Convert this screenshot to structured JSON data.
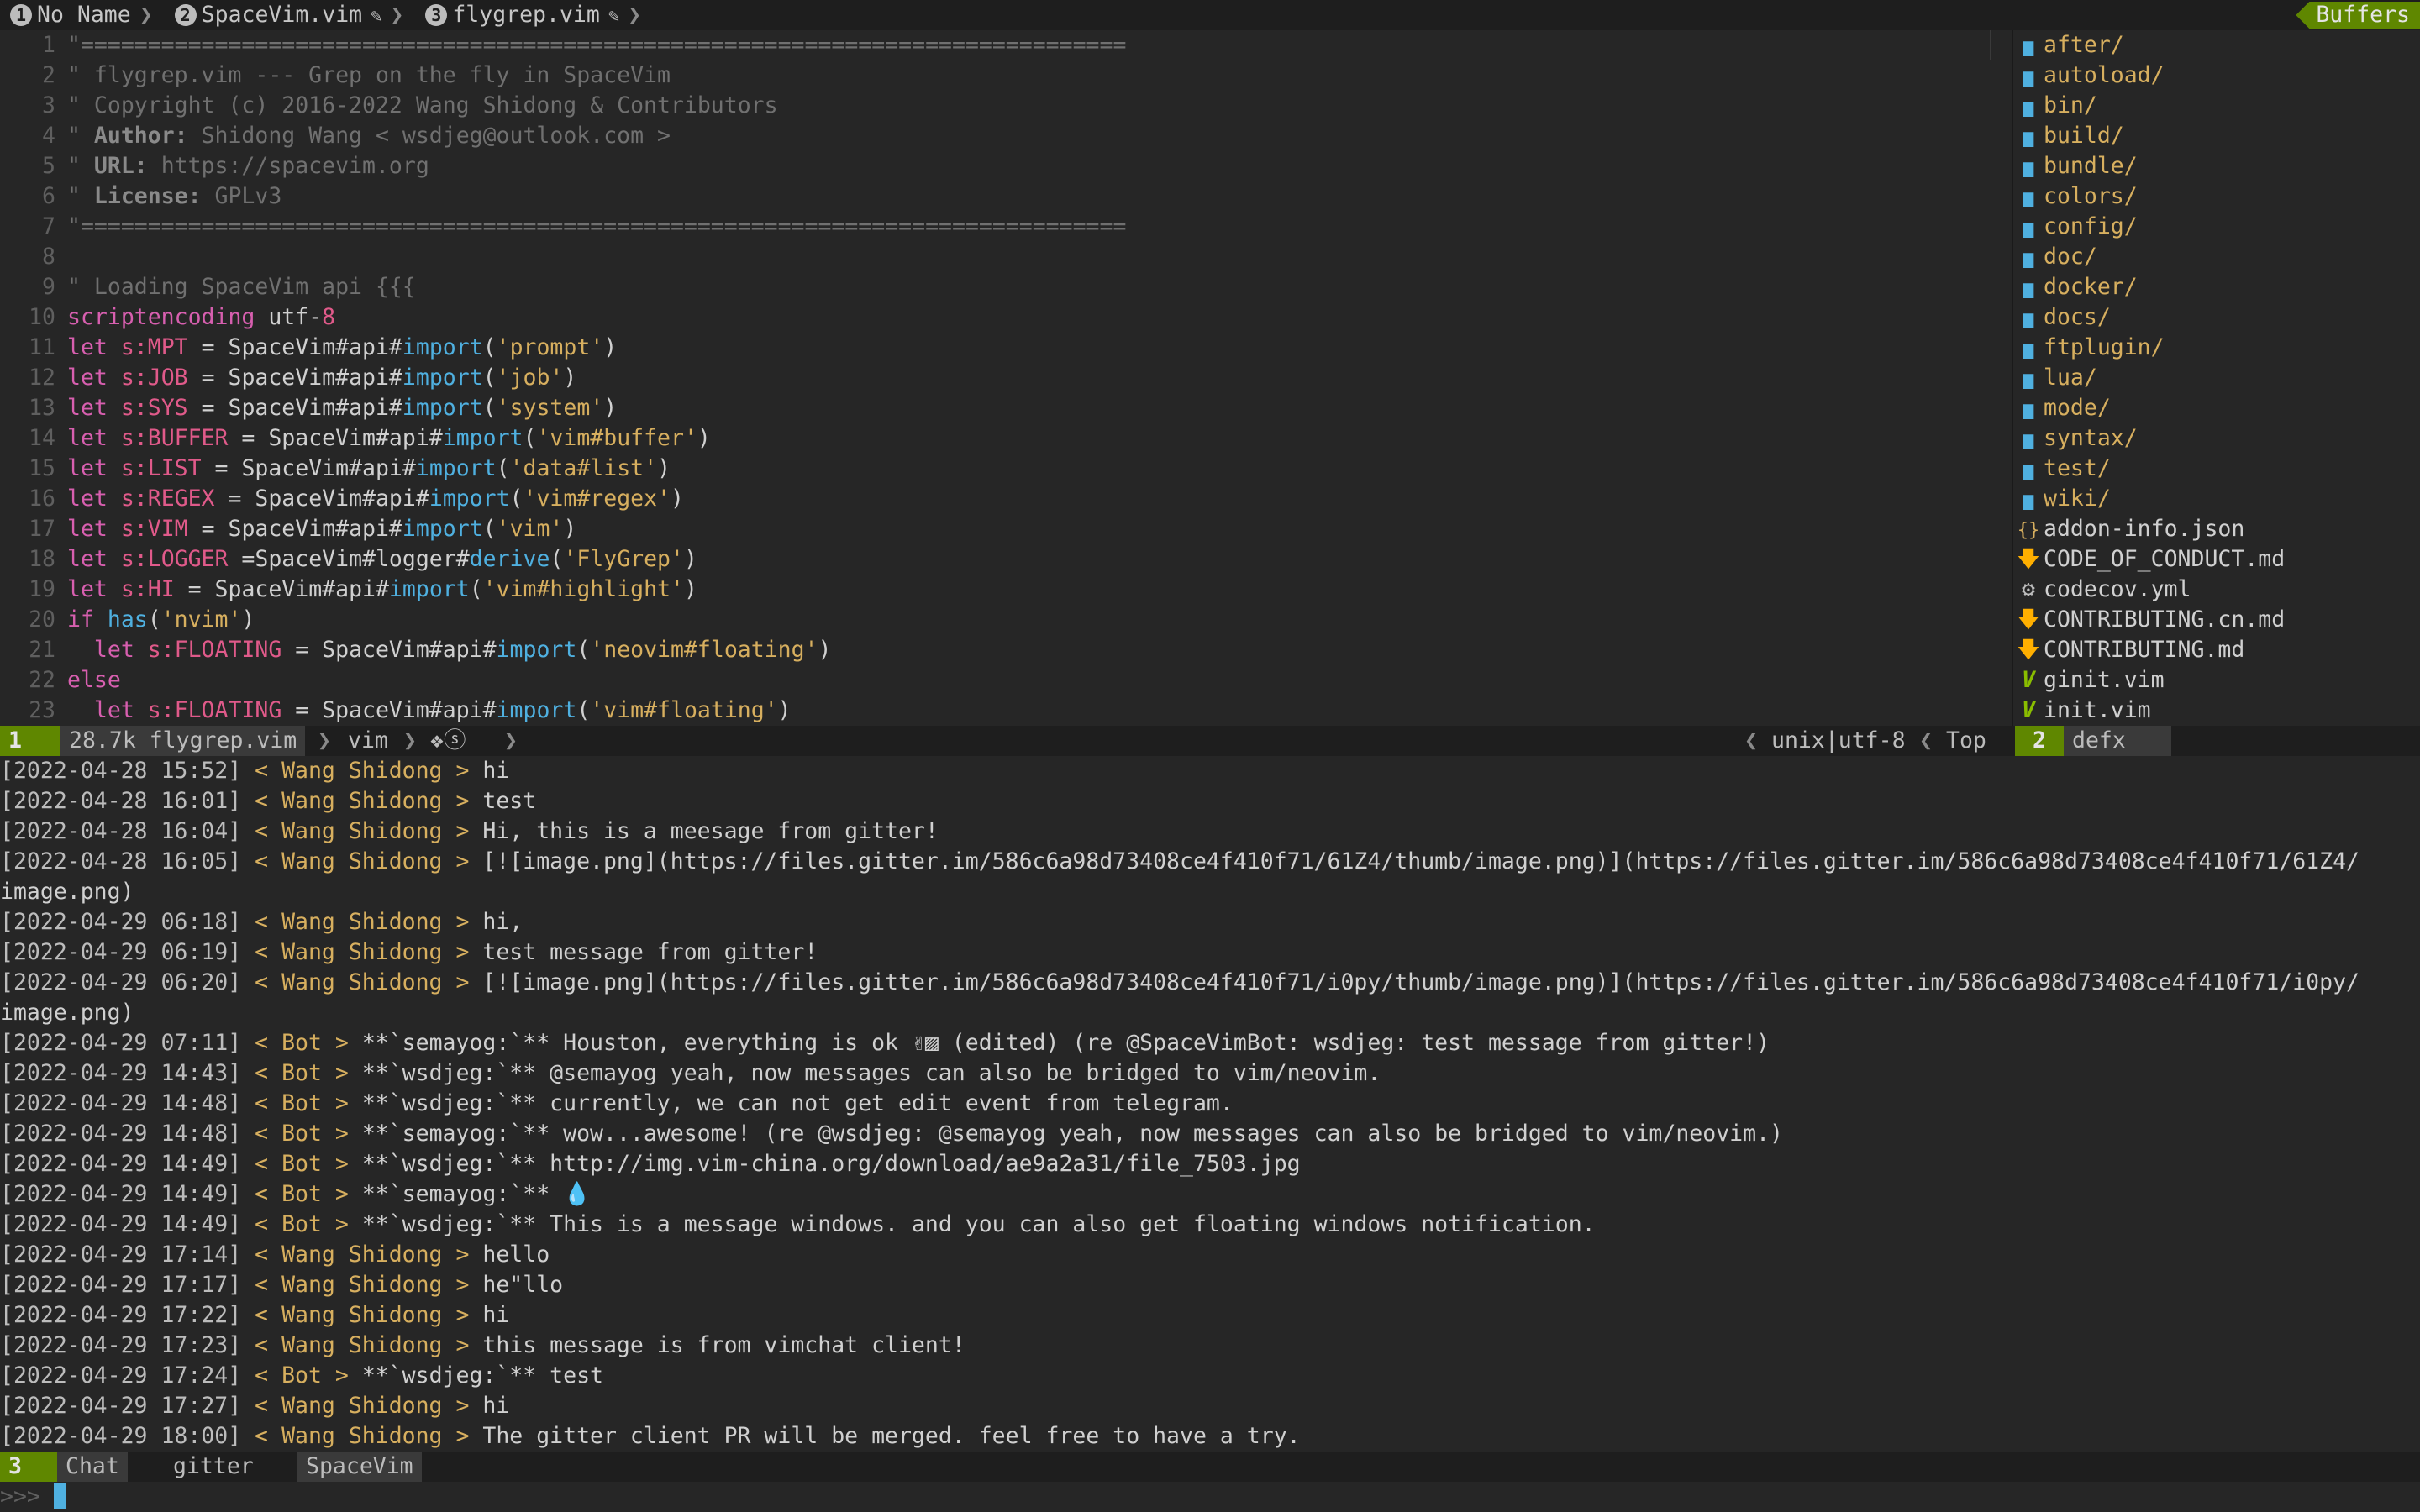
{
  "tabs": [
    {
      "num": "1",
      "label": "No Name",
      "modified": false
    },
    {
      "num": "2",
      "label": "SpaceVim.vim",
      "modified": true
    },
    {
      "num": "3",
      "label": "flygrep.vim",
      "modified": true
    }
  ],
  "buffers_label": "Buffers",
  "editor_lines": [
    {
      "n": "1",
      "tokens": [
        {
          "t": "\"==============================================================================",
          "c": "cmt"
        }
      ]
    },
    {
      "n": "2",
      "tokens": [
        {
          "t": "\" flygrep.vim --- Grep on the fly in SpaceVim",
          "c": "cmt"
        }
      ]
    },
    {
      "n": "3",
      "tokens": [
        {
          "t": "\" Copyright (c) 2016-2022 Wang Shidong & Contributors",
          "c": "cmt"
        }
      ]
    },
    {
      "n": "4",
      "tokens": [
        {
          "t": "\" ",
          "c": "cmt"
        },
        {
          "t": "Author:",
          "c": "bold"
        },
        {
          "t": " Shidong Wang < wsdjeg@outlook.com >",
          "c": "cmt"
        }
      ]
    },
    {
      "n": "5",
      "tokens": [
        {
          "t": "\" ",
          "c": "cmt"
        },
        {
          "t": "URL:",
          "c": "bold"
        },
        {
          "t": " https://spacevim.org",
          "c": "cmt"
        }
      ]
    },
    {
      "n": "6",
      "tokens": [
        {
          "t": "\" ",
          "c": "cmt"
        },
        {
          "t": "License:",
          "c": "bold"
        },
        {
          "t": " GPLv3",
          "c": "cmt"
        }
      ]
    },
    {
      "n": "7",
      "tokens": [
        {
          "t": "\"==============================================================================",
          "c": "cmt"
        }
      ]
    },
    {
      "n": "8",
      "tokens": []
    },
    {
      "n": "9",
      "tokens": [
        {
          "t": "\" Loading SpaceVim api {{{",
          "c": "cmt"
        }
      ]
    },
    {
      "n": "10",
      "tokens": [
        {
          "t": "scriptencoding",
          "c": "kw"
        },
        {
          "t": " utf-",
          "c": ""
        },
        {
          "t": "8",
          "c": "var"
        }
      ]
    },
    {
      "n": "11",
      "tokens": [
        {
          "t": "let ",
          "c": "kw"
        },
        {
          "t": "s:MPT",
          "c": "var"
        },
        {
          "t": " = ",
          "c": ""
        },
        {
          "t": "SpaceVim#api#",
          "c": ""
        },
        {
          "t": "import",
          "c": "fn"
        },
        {
          "t": "(",
          "c": ""
        },
        {
          "t": "'prompt'",
          "c": "str"
        },
        {
          "t": ")",
          "c": ""
        }
      ]
    },
    {
      "n": "12",
      "tokens": [
        {
          "t": "let ",
          "c": "kw"
        },
        {
          "t": "s:JOB",
          "c": "var"
        },
        {
          "t": " = ",
          "c": ""
        },
        {
          "t": "SpaceVim#api#",
          "c": ""
        },
        {
          "t": "import",
          "c": "fn"
        },
        {
          "t": "(",
          "c": ""
        },
        {
          "t": "'job'",
          "c": "str"
        },
        {
          "t": ")",
          "c": ""
        }
      ]
    },
    {
      "n": "13",
      "tokens": [
        {
          "t": "let ",
          "c": "kw"
        },
        {
          "t": "s:SYS",
          "c": "var"
        },
        {
          "t": " = ",
          "c": ""
        },
        {
          "t": "SpaceVim#api#",
          "c": ""
        },
        {
          "t": "import",
          "c": "fn"
        },
        {
          "t": "(",
          "c": ""
        },
        {
          "t": "'system'",
          "c": "str"
        },
        {
          "t": ")",
          "c": ""
        }
      ]
    },
    {
      "n": "14",
      "tokens": [
        {
          "t": "let ",
          "c": "kw"
        },
        {
          "t": "s:BUFFER",
          "c": "var"
        },
        {
          "t": " = ",
          "c": ""
        },
        {
          "t": "SpaceVim#api#",
          "c": ""
        },
        {
          "t": "import",
          "c": "fn"
        },
        {
          "t": "(",
          "c": ""
        },
        {
          "t": "'vim#buffer'",
          "c": "str"
        },
        {
          "t": ")",
          "c": ""
        }
      ]
    },
    {
      "n": "15",
      "tokens": [
        {
          "t": "let ",
          "c": "kw"
        },
        {
          "t": "s:LIST",
          "c": "var"
        },
        {
          "t": " = ",
          "c": ""
        },
        {
          "t": "SpaceVim#api#",
          "c": ""
        },
        {
          "t": "import",
          "c": "fn"
        },
        {
          "t": "(",
          "c": ""
        },
        {
          "t": "'data#list'",
          "c": "str"
        },
        {
          "t": ")",
          "c": ""
        }
      ]
    },
    {
      "n": "16",
      "tokens": [
        {
          "t": "let ",
          "c": "kw"
        },
        {
          "t": "s:REGEX",
          "c": "var"
        },
        {
          "t": " = ",
          "c": ""
        },
        {
          "t": "SpaceVim#api#",
          "c": ""
        },
        {
          "t": "import",
          "c": "fn"
        },
        {
          "t": "(",
          "c": ""
        },
        {
          "t": "'vim#regex'",
          "c": "str"
        },
        {
          "t": ")",
          "c": ""
        }
      ]
    },
    {
      "n": "17",
      "tokens": [
        {
          "t": "let ",
          "c": "kw"
        },
        {
          "t": "s:VIM",
          "c": "var"
        },
        {
          "t": " = ",
          "c": ""
        },
        {
          "t": "SpaceVim#api#",
          "c": ""
        },
        {
          "t": "import",
          "c": "fn"
        },
        {
          "t": "(",
          "c": ""
        },
        {
          "t": "'vim'",
          "c": "str"
        },
        {
          "t": ")",
          "c": ""
        }
      ]
    },
    {
      "n": "18",
      "tokens": [
        {
          "t": "let ",
          "c": "kw"
        },
        {
          "t": "s:LOGGER",
          "c": "var"
        },
        {
          "t": " =",
          "c": ""
        },
        {
          "t": "SpaceVim#logger#",
          "c": ""
        },
        {
          "t": "derive",
          "c": "fn"
        },
        {
          "t": "(",
          "c": ""
        },
        {
          "t": "'FlyGrep'",
          "c": "str"
        },
        {
          "t": ")",
          "c": ""
        }
      ]
    },
    {
      "n": "19",
      "tokens": [
        {
          "t": "let ",
          "c": "kw"
        },
        {
          "t": "s:HI",
          "c": "var"
        },
        {
          "t": " = ",
          "c": ""
        },
        {
          "t": "SpaceVim#api#",
          "c": ""
        },
        {
          "t": "import",
          "c": "fn"
        },
        {
          "t": "(",
          "c": ""
        },
        {
          "t": "'vim#highlight'",
          "c": "str"
        },
        {
          "t": ")",
          "c": ""
        }
      ]
    },
    {
      "n": "20",
      "tokens": [
        {
          "t": "if ",
          "c": "kw"
        },
        {
          "t": "has",
          "c": "fn"
        },
        {
          "t": "(",
          "c": ""
        },
        {
          "t": "'nvim'",
          "c": "str"
        },
        {
          "t": ")",
          "c": ""
        }
      ]
    },
    {
      "n": "21",
      "tokens": [
        {
          "t": "  let ",
          "c": "kw"
        },
        {
          "t": "s:FLOATING",
          "c": "var"
        },
        {
          "t": " = ",
          "c": ""
        },
        {
          "t": "SpaceVim#api#",
          "c": ""
        },
        {
          "t": "import",
          "c": "fn"
        },
        {
          "t": "(",
          "c": ""
        },
        {
          "t": "'neovim#floating'",
          "c": "str"
        },
        {
          "t": ")",
          "c": ""
        }
      ]
    },
    {
      "n": "22",
      "tokens": [
        {
          "t": "else",
          "c": "kw"
        }
      ]
    },
    {
      "n": "23",
      "tokens": [
        {
          "t": "  let ",
          "c": "kw"
        },
        {
          "t": "s:FLOATING",
          "c": "var"
        },
        {
          "t": " = ",
          "c": ""
        },
        {
          "t": "SpaceVim#api#",
          "c": ""
        },
        {
          "t": "import",
          "c": "fn"
        },
        {
          "t": "(",
          "c": ""
        },
        {
          "t": "'vim#floating'",
          "c": "str"
        },
        {
          "t": ")",
          "c": ""
        }
      ]
    }
  ],
  "defx": [
    {
      "name": "after/",
      "kind": "dir",
      "icon": "folder-icon"
    },
    {
      "name": "autoload/",
      "kind": "dir",
      "icon": "folder-icon"
    },
    {
      "name": "bin/",
      "kind": "dir",
      "icon": "folder-icon"
    },
    {
      "name": "build/",
      "kind": "dir",
      "icon": "folder-icon"
    },
    {
      "name": "bundle/",
      "kind": "dir",
      "icon": "folder-icon"
    },
    {
      "name": "colors/",
      "kind": "dir",
      "icon": "folder-icon"
    },
    {
      "name": "config/",
      "kind": "dir",
      "icon": "folder-icon"
    },
    {
      "name": "doc/",
      "kind": "dir",
      "icon": "folder-icon"
    },
    {
      "name": "docker/",
      "kind": "dir",
      "icon": "folder-icon"
    },
    {
      "name": "docs/",
      "kind": "dir",
      "icon": "folder-icon"
    },
    {
      "name": "ftplugin/",
      "kind": "dir",
      "icon": "folder-icon"
    },
    {
      "name": "lua/",
      "kind": "dir",
      "icon": "folder-icon"
    },
    {
      "name": "mode/",
      "kind": "dir",
      "icon": "folder-icon"
    },
    {
      "name": "syntax/",
      "kind": "dir",
      "icon": "folder-icon"
    },
    {
      "name": "test/",
      "kind": "dir",
      "icon": "folder-icon"
    },
    {
      "name": "wiki/",
      "kind": "dir",
      "icon": "folder-icon"
    },
    {
      "name": "addon-info.json",
      "kind": "file",
      "icon": "json-icon"
    },
    {
      "name": "CODE_OF_CONDUCT.md",
      "kind": "file",
      "icon": "markdown-icon"
    },
    {
      "name": "codecov.yml",
      "kind": "file",
      "icon": "gear-icon"
    },
    {
      "name": "CONTRIBUTING.cn.md",
      "kind": "file",
      "icon": "markdown-icon"
    },
    {
      "name": "CONTRIBUTING.md",
      "kind": "file",
      "icon": "markdown-icon"
    },
    {
      "name": "ginit.vim",
      "kind": "file",
      "icon": "vim-icon"
    },
    {
      "name": "init.vim",
      "kind": "file",
      "icon": "vim-icon"
    }
  ],
  "status1": {
    "win": "1",
    "size_file": "28.7k flygrep.vim",
    "filetype": "vim",
    "indicators": "❖ⓢ",
    "format": "unix|utf-8",
    "position": "Top",
    "win2": "2",
    "win2_name": "defx"
  },
  "chat": [
    {
      "ts": "[2022-04-28 15:52]",
      "nick": "Wang Shidong",
      "msg": "hi"
    },
    {
      "ts": "[2022-04-28 16:01]",
      "nick": "Wang Shidong",
      "msg": "test"
    },
    {
      "ts": "[2022-04-28 16:04]",
      "nick": "Wang Shidong",
      "msg": "Hi, this is a meesage from gitter!"
    },
    {
      "ts": "[2022-04-28 16:05]",
      "nick": "Wang Shidong",
      "msg": "[![image.png](https://files.gitter.im/586c6a98d73408ce4f410f71/61Z4/thumb/image.png)](https://files.gitter.im/586c6a98d73408ce4f410f71/61Z4/",
      "cont": "image.png)"
    },
    {
      "ts": "[2022-04-29 06:18]",
      "nick": "Wang Shidong",
      "msg": "hi,"
    },
    {
      "ts": "[2022-04-29 06:19]",
      "nick": "Wang Shidong",
      "msg": "test message from gitter!"
    },
    {
      "ts": "[2022-04-29 06:20]",
      "nick": "Wang Shidong",
      "msg": "[![image.png](https://files.gitter.im/586c6a98d73408ce4f410f71/i0py/thumb/image.png)](https://files.gitter.im/586c6a98d73408ce4f410f71/i0py/",
      "cont": "image.png)"
    },
    {
      "ts": "[2022-04-29 07:11]",
      "nick": "Bot",
      "msg": "**`semayog:`** Houston, everything is ok ✌▨ (edited) (re @SpaceVimBot: wsdjeg: test message from gitter!)"
    },
    {
      "ts": "[2022-04-29 14:43]",
      "nick": "Bot",
      "msg": "**`wsdjeg:`** @semayog yeah, now messages can also be bridged to vim/neovim."
    },
    {
      "ts": "[2022-04-29 14:48]",
      "nick": "Bot",
      "msg": "**`wsdjeg:`** currently, we can not get edit event from telegram."
    },
    {
      "ts": "[2022-04-29 14:48]",
      "nick": "Bot",
      "msg": "**`semayog:`** wow...awesome! (re @wsdjeg: @semayog yeah, now messages can also be bridged to vim/neovim.)"
    },
    {
      "ts": "[2022-04-29 14:49]",
      "nick": "Bot",
      "msg": "**`wsdjeg:`** http://img.vim-china.org/download/ae9a2a31/file_7503.jpg"
    },
    {
      "ts": "[2022-04-29 14:49]",
      "nick": "Bot",
      "msg": "**`semayog:`** 💧"
    },
    {
      "ts": "[2022-04-29 14:49]",
      "nick": "Bot",
      "msg": "**`wsdjeg:`** This is a message windows. and you can also get floating windows notification."
    },
    {
      "ts": "[2022-04-29 17:14]",
      "nick": "Wang Shidong",
      "msg": "hello"
    },
    {
      "ts": "[2022-04-29 17:17]",
      "nick": "Wang Shidong",
      "msg": "he\"llo"
    },
    {
      "ts": "[2022-04-29 17:22]",
      "nick": "Wang Shidong",
      "msg": "hi"
    },
    {
      "ts": "[2022-04-29 17:23]",
      "nick": "Wang Shidong",
      "msg": "this message is from vimchat client!"
    },
    {
      "ts": "[2022-04-29 17:24]",
      "nick": "Bot",
      "msg": "**`wsdjeg:`** test"
    },
    {
      "ts": "[2022-04-29 17:27]",
      "nick": "Wang Shidong",
      "msg": "hi"
    },
    {
      "ts": "[2022-04-29 18:00]",
      "nick": "Wang Shidong",
      "msg": "The gitter client PR will be merged. feel free to have a try."
    }
  ],
  "status3": {
    "win": "3",
    "mode": "Chat",
    "protocol": "gitter",
    "channel": "SpaceVim"
  },
  "prompt": ">>> "
}
